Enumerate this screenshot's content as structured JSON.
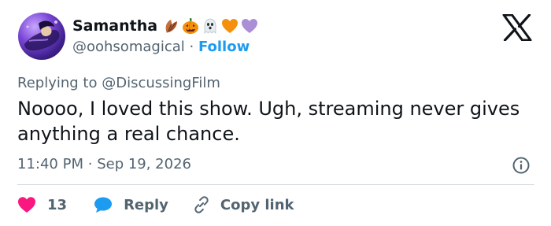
{
  "tweet": {
    "display_name": "Samantha",
    "name_emojis": [
      "leaf-emoji",
      "jack-o-lantern-emoji",
      "ghost-emoji",
      "orange-heart-emoji",
      "purple-heart-emoji"
    ],
    "handle": "@oohsomagical",
    "separator": "·",
    "follow_label": "Follow",
    "replying_prefix": "Replying to",
    "replying_to": "@DiscussingFilm",
    "text": "Noooo, I loved this show. Ugh, streaming never gives anything a real chance.",
    "time": "11:40 PM",
    "date_separator": "·",
    "date": "Sep 19, 2026"
  },
  "actions": {
    "likes_count": "13",
    "reply_label": "Reply",
    "copy_link_label": "Copy link"
  },
  "colors": {
    "accent": "#1d9bf0",
    "like": "#f91880",
    "reply": "#1d9bf0",
    "secondary_text": "#536471",
    "primary_text": "#0f1419",
    "divider": "#cfd9de"
  },
  "icons": {
    "brand": "x-logo-icon",
    "info": "info-icon",
    "like": "heart-icon",
    "reply": "speech-bubble-icon",
    "copy": "link-icon"
  }
}
